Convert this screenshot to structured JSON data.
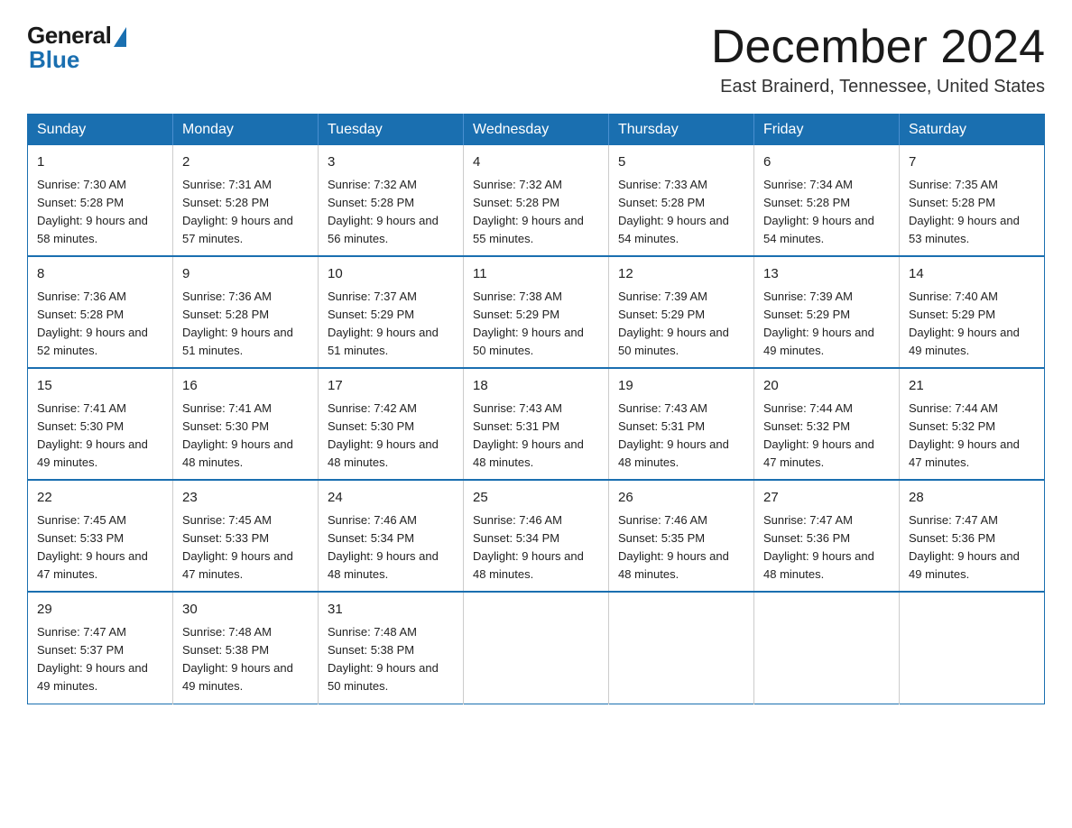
{
  "logo": {
    "general": "General",
    "blue": "Blue"
  },
  "title": {
    "month": "December 2024",
    "location": "East Brainerd, Tennessee, United States"
  },
  "days_of_week": [
    "Sunday",
    "Monday",
    "Tuesday",
    "Wednesday",
    "Thursday",
    "Friday",
    "Saturday"
  ],
  "weeks": [
    [
      {
        "day": "1",
        "sunrise": "7:30 AM",
        "sunset": "5:28 PM",
        "daylight": "9 hours and 58 minutes."
      },
      {
        "day": "2",
        "sunrise": "7:31 AM",
        "sunset": "5:28 PM",
        "daylight": "9 hours and 57 minutes."
      },
      {
        "day": "3",
        "sunrise": "7:32 AM",
        "sunset": "5:28 PM",
        "daylight": "9 hours and 56 minutes."
      },
      {
        "day": "4",
        "sunrise": "7:32 AM",
        "sunset": "5:28 PM",
        "daylight": "9 hours and 55 minutes."
      },
      {
        "day": "5",
        "sunrise": "7:33 AM",
        "sunset": "5:28 PM",
        "daylight": "9 hours and 54 minutes."
      },
      {
        "day": "6",
        "sunrise": "7:34 AM",
        "sunset": "5:28 PM",
        "daylight": "9 hours and 54 minutes."
      },
      {
        "day": "7",
        "sunrise": "7:35 AM",
        "sunset": "5:28 PM",
        "daylight": "9 hours and 53 minutes."
      }
    ],
    [
      {
        "day": "8",
        "sunrise": "7:36 AM",
        "sunset": "5:28 PM",
        "daylight": "9 hours and 52 minutes."
      },
      {
        "day": "9",
        "sunrise": "7:36 AM",
        "sunset": "5:28 PM",
        "daylight": "9 hours and 51 minutes."
      },
      {
        "day": "10",
        "sunrise": "7:37 AM",
        "sunset": "5:29 PM",
        "daylight": "9 hours and 51 minutes."
      },
      {
        "day": "11",
        "sunrise": "7:38 AM",
        "sunset": "5:29 PM",
        "daylight": "9 hours and 50 minutes."
      },
      {
        "day": "12",
        "sunrise": "7:39 AM",
        "sunset": "5:29 PM",
        "daylight": "9 hours and 50 minutes."
      },
      {
        "day": "13",
        "sunrise": "7:39 AM",
        "sunset": "5:29 PM",
        "daylight": "9 hours and 49 minutes."
      },
      {
        "day": "14",
        "sunrise": "7:40 AM",
        "sunset": "5:29 PM",
        "daylight": "9 hours and 49 minutes."
      }
    ],
    [
      {
        "day": "15",
        "sunrise": "7:41 AM",
        "sunset": "5:30 PM",
        "daylight": "9 hours and 49 minutes."
      },
      {
        "day": "16",
        "sunrise": "7:41 AM",
        "sunset": "5:30 PM",
        "daylight": "9 hours and 48 minutes."
      },
      {
        "day": "17",
        "sunrise": "7:42 AM",
        "sunset": "5:30 PM",
        "daylight": "9 hours and 48 minutes."
      },
      {
        "day": "18",
        "sunrise": "7:43 AM",
        "sunset": "5:31 PM",
        "daylight": "9 hours and 48 minutes."
      },
      {
        "day": "19",
        "sunrise": "7:43 AM",
        "sunset": "5:31 PM",
        "daylight": "9 hours and 48 minutes."
      },
      {
        "day": "20",
        "sunrise": "7:44 AM",
        "sunset": "5:32 PM",
        "daylight": "9 hours and 47 minutes."
      },
      {
        "day": "21",
        "sunrise": "7:44 AM",
        "sunset": "5:32 PM",
        "daylight": "9 hours and 47 minutes."
      }
    ],
    [
      {
        "day": "22",
        "sunrise": "7:45 AM",
        "sunset": "5:33 PM",
        "daylight": "9 hours and 47 minutes."
      },
      {
        "day": "23",
        "sunrise": "7:45 AM",
        "sunset": "5:33 PM",
        "daylight": "9 hours and 47 minutes."
      },
      {
        "day": "24",
        "sunrise": "7:46 AM",
        "sunset": "5:34 PM",
        "daylight": "9 hours and 48 minutes."
      },
      {
        "day": "25",
        "sunrise": "7:46 AM",
        "sunset": "5:34 PM",
        "daylight": "9 hours and 48 minutes."
      },
      {
        "day": "26",
        "sunrise": "7:46 AM",
        "sunset": "5:35 PM",
        "daylight": "9 hours and 48 minutes."
      },
      {
        "day": "27",
        "sunrise": "7:47 AM",
        "sunset": "5:36 PM",
        "daylight": "9 hours and 48 minutes."
      },
      {
        "day": "28",
        "sunrise": "7:47 AM",
        "sunset": "5:36 PM",
        "daylight": "9 hours and 49 minutes."
      }
    ],
    [
      {
        "day": "29",
        "sunrise": "7:47 AM",
        "sunset": "5:37 PM",
        "daylight": "9 hours and 49 minutes."
      },
      {
        "day": "30",
        "sunrise": "7:48 AM",
        "sunset": "5:38 PM",
        "daylight": "9 hours and 49 minutes."
      },
      {
        "day": "31",
        "sunrise": "7:48 AM",
        "sunset": "5:38 PM",
        "daylight": "9 hours and 50 minutes."
      },
      null,
      null,
      null,
      null
    ]
  ]
}
